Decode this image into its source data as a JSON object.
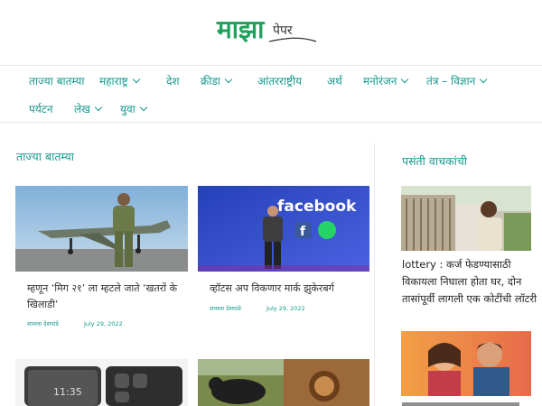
{
  "site": {
    "logo_text": "माझापेपर"
  },
  "nav": {
    "items": [
      {
        "label": "ताज्या बातम्या",
        "has_dropdown": false
      },
      {
        "label": "महाराष्ट्र",
        "has_dropdown": true
      },
      {
        "label": "देश",
        "has_dropdown": false
      },
      {
        "label": "क्रीडा",
        "has_dropdown": true
      },
      {
        "label": "आंतरराष्ट्रीय",
        "has_dropdown": false
      },
      {
        "label": "अर्थ",
        "has_dropdown": false
      },
      {
        "label": "मनोरंजन",
        "has_dropdown": true
      },
      {
        "label": "तंत्र – विज्ञान",
        "has_dropdown": true
      },
      {
        "label": "पर्यटन",
        "has_dropdown": false
      },
      {
        "label": "लेख",
        "has_dropdown": true
      },
      {
        "label": "युवा",
        "has_dropdown": true
      }
    ]
  },
  "main": {
    "section_title": "ताज्या बातम्या",
    "articles": [
      {
        "title": "म्हणून ‘मिग २१’ ला म्हटले जाते ‘खतरों के खिलाडी’",
        "author": "शामला देशपांडे",
        "date": "July 29, 2022"
      },
      {
        "title": "व्हॉटस अप विकणार मार्क झुकेरबर्ग",
        "author": "शामला देशपांडे",
        "date": "July 29, 2022"
      }
    ]
  },
  "sidebar": {
    "title": "पसंती वाचकांची",
    "articles": [
      {
        "title": "lottery : कर्ज फेडण्यासाठी विकायला निघाला होता घर, दोन तासांपूर्वी लागली एक कोटींची लॉटरी"
      }
    ]
  },
  "colors": {
    "accent": "#15998e",
    "logo_green": "#1fa15c",
    "facebook_blue": "#3b5bdb"
  }
}
